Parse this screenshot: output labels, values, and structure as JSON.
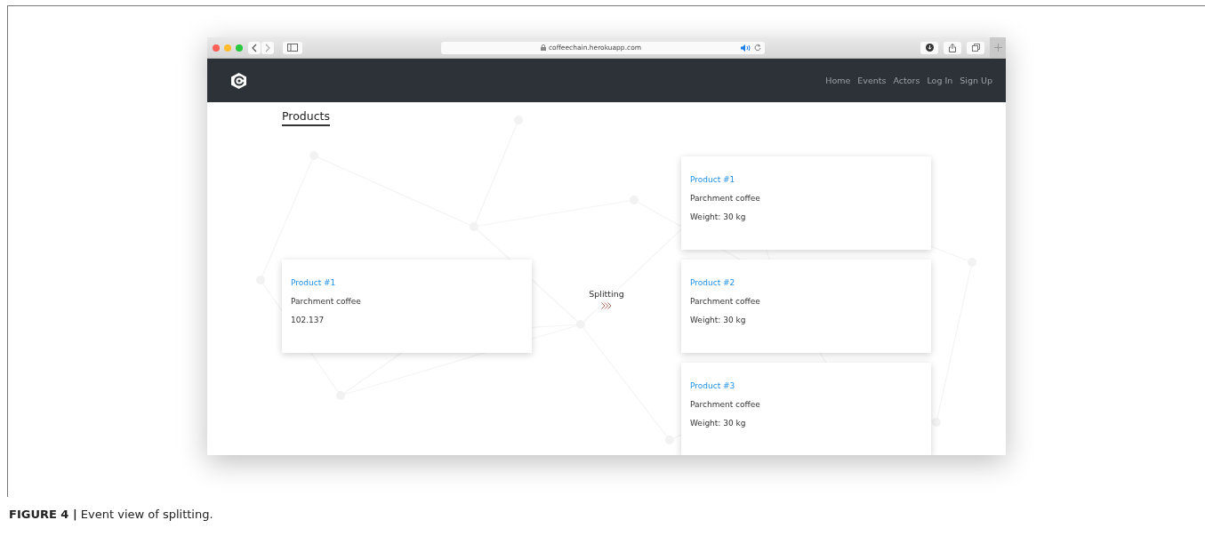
{
  "browser": {
    "url": "coffeechain.herokuapp.com"
  },
  "nav": {
    "links": [
      "Home",
      "Events",
      "Actors",
      "Log In",
      "Sign Up"
    ]
  },
  "page": {
    "title": "Products"
  },
  "event": {
    "label": "Splitting",
    "input": {
      "title": "Product #1",
      "name": "Parchment coffee",
      "detail": "102.137"
    },
    "outputs": [
      {
        "title": "Product #1",
        "name": "Parchment coffee",
        "detail": "Weight: 30 kg"
      },
      {
        "title": "Product #2",
        "name": "Parchment coffee",
        "detail": "Weight: 30 kg"
      },
      {
        "title": "Product #3",
        "name": "Parchment coffee",
        "detail": "Weight: 30 kg"
      }
    ]
  },
  "caption": "**FIGURE 4 |** Event view of splitting."
}
